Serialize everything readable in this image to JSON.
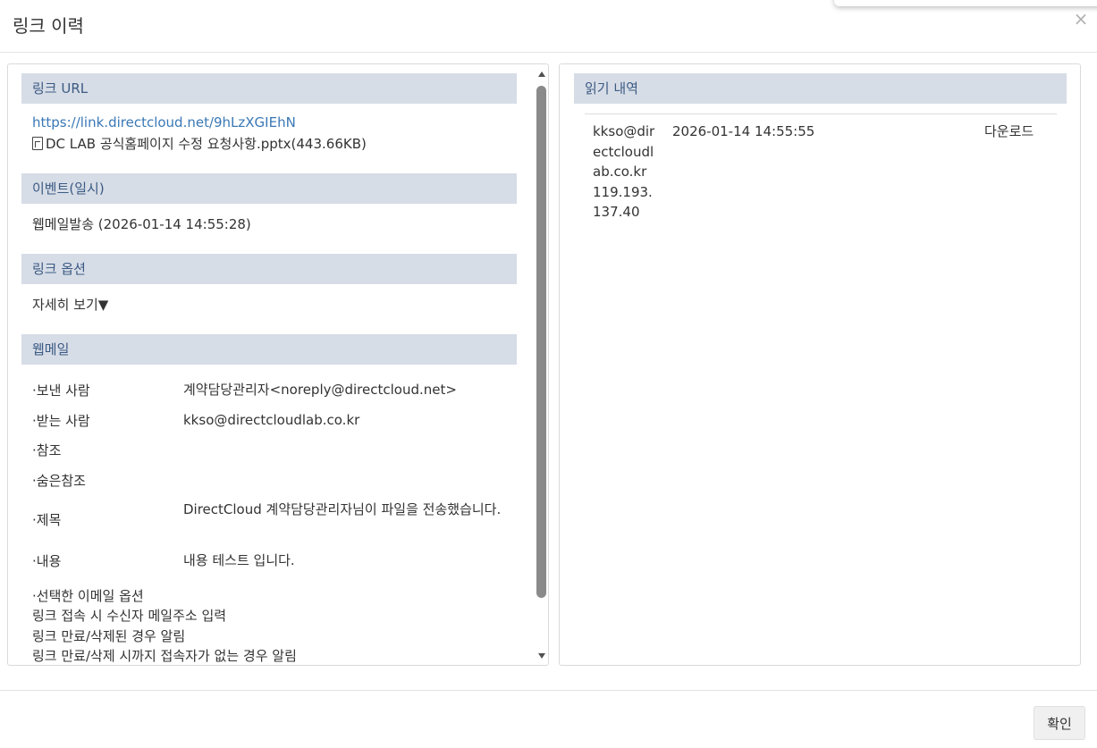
{
  "modal": {
    "title": "링크 이력",
    "close_symbol": "×",
    "confirm_label": "확인"
  },
  "left_panel": {
    "link_url": {
      "header": "링크 URL",
      "url": "https://link.directcloud.net/9hLzXGIEhN",
      "file_icon": "file-icon",
      "file_name": "DC LAB 공식홈페이지 수정 요청사항.pptx(443.66KB)"
    },
    "event": {
      "header": "이벤트(일시)",
      "text": "웹메일발송 (2026-01-14 14:55:28)"
    },
    "link_options": {
      "header": "링크 옵션",
      "details_toggle": "자세히 보기▼"
    },
    "webmail": {
      "header": "웹메일",
      "fields": [
        {
          "label": "·보낸 사람",
          "value": "계약담당관리자<noreply@directcloud.net>"
        },
        {
          "label": "·받는 사람",
          "value": "kkso@directcloudlab.co.kr"
        },
        {
          "label": "·참조",
          "value": ""
        },
        {
          "label": "·숨은참조",
          "value": ""
        },
        {
          "label": "·제목",
          "value": "DirectCloud 계약담당관리자님이 파일을 전송했습니다."
        },
        {
          "label": "·내용",
          "value": "내용 테스트 입니다."
        }
      ],
      "selected_options": {
        "title": "·선택한 이메일 옵션",
        "items": [
          "링크 접속 시 수신자 메일주소 입력",
          "링크 만료/삭제된 경우 알림",
          "링크 만료/삭제 시까지 접속자가 없는 경우 알림"
        ]
      }
    }
  },
  "right_panel": {
    "header": "읽기 내역",
    "rows": [
      {
        "user_lines": [
          "kkso@dir",
          "ectcloudl",
          "ab.co.kr",
          "119.193.",
          "137.40"
        ],
        "datetime": "2026-01-14 14:55:55",
        "action": "다운로드"
      }
    ]
  },
  "colors": {
    "section_header_bg": "#d7dde7",
    "section_header_text": "#3b5a83",
    "link": "#3a78b6"
  }
}
